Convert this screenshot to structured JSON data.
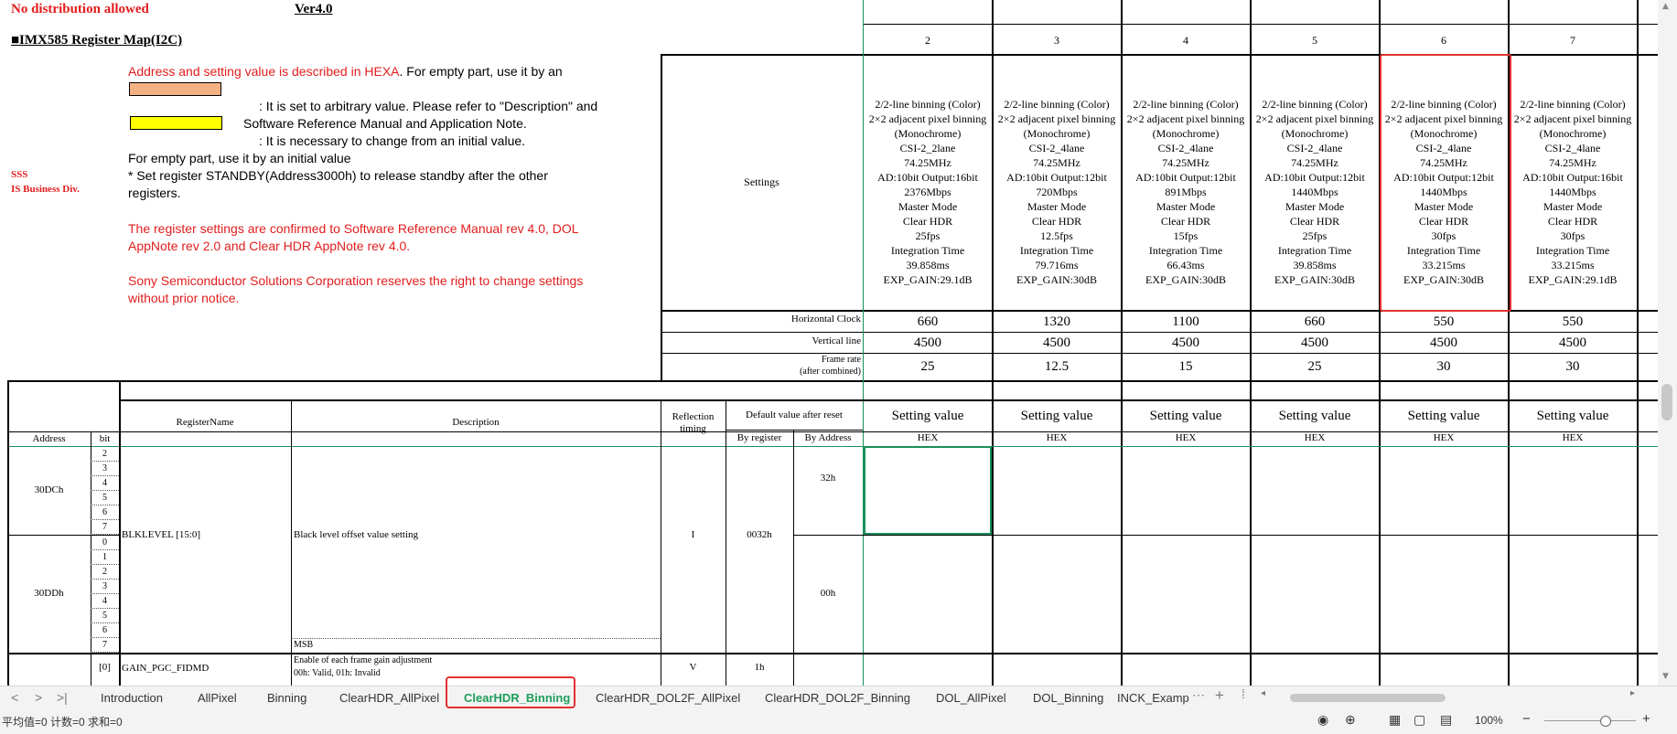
{
  "header": {
    "no_distribution": "No distribution allowed",
    "version": "Ver4.0",
    "map_title": "■IMX585 Register Map(I2C)",
    "sss": "SSS",
    "is_div": "IS Business Div."
  },
  "notes": {
    "line1": "Address and setting value is described in HEXA",
    "line1_rest": ". For empty part, use it by an",
    "orange_desc": ": It is set to arbitrary value. Please refer to \"Description\" and",
    "orange_desc2": "Software Reference Manual and Application Note.",
    "yellow_desc": ": It is necessary to change from an initial value.",
    "empty_part": "For empty part, use it by an initial value",
    "standby": "* Set register STANDBY(Address3000h) to release standby after the other",
    "standby2": "registers.",
    "confirmed1": "The register settings are confirmed to Software Reference Manual rev 4.0, DOL",
    "confirmed2": "AppNote rev 2.0 and Clear HDR AppNote rev 4.0.",
    "sony1": "Sony Semiconductor Solutions Corporation reserves the right to change settings",
    "sony2": "without  prior notice.",
    "colors": {
      "orange": "#f4b183",
      "yellow": "#ffff00",
      "red": "#e21d1d"
    }
  },
  "settings_label": "Settings",
  "row_labels": {
    "hclock": "Horizontal Clock",
    "vline": "Vertical line",
    "frame_rate_1": "Frame rate",
    "frame_rate_2": "(after combined)"
  },
  "columns": [
    {
      "num": "2",
      "lines": [
        "2/2-line binning (Color)",
        "2×2 adjacent pixel binning",
        "(Monochrome)",
        "CSI-2_2lane",
        "74.25MHz",
        "AD:10bit Output:16bit",
        "2376Mbps",
        "Master Mode",
        "Clear HDR",
        "25fps",
        "Integration Time",
        "39.858ms",
        "EXP_GAIN:29.1dB"
      ],
      "hclock": "660",
      "vline": "4500",
      "fps": "25",
      "sv": "Setting value",
      "hex": "HEX"
    },
    {
      "num": "3",
      "lines": [
        "2/2-line binning (Color)",
        "2×2 adjacent pixel binning",
        "(Monochrome)",
        "CSI-2_4lane",
        "74.25MHz",
        "AD:10bit Output:12bit",
        "720Mbps",
        "Master Mode",
        "Clear HDR",
        "12.5fps",
        "Integration Time",
        "79.716ms",
        "EXP_GAIN:30dB"
      ],
      "hclock": "1320",
      "vline": "4500",
      "fps": "12.5",
      "sv": "Setting value",
      "hex": "HEX"
    },
    {
      "num": "4",
      "lines": [
        "2/2-line binning (Color)",
        "2×2 adjacent pixel binning",
        "(Monochrome)",
        "CSI-2_4lane",
        "74.25MHz",
        "AD:10bit Output:12bit",
        "891Mbps",
        "Master Mode",
        "Clear HDR",
        "15fps",
        "Integration Time",
        "66.43ms",
        "EXP_GAIN:30dB"
      ],
      "hclock": "1100",
      "vline": "4500",
      "fps": "15",
      "sv": "Setting value",
      "hex": "HEX"
    },
    {
      "num": "5",
      "lines": [
        "2/2-line binning (Color)",
        "2×2 adjacent pixel binning",
        "(Monochrome)",
        "CSI-2_4lane",
        "74.25MHz",
        "AD:10bit Output:12bit",
        "1440Mbps",
        "Master Mode",
        "Clear HDR",
        "25fps",
        "Integration Time",
        "39.858ms",
        "EXP_GAIN:30dB"
      ],
      "hclock": "660",
      "vline": "4500",
      "fps": "25",
      "sv": "Setting value",
      "hex": "HEX"
    },
    {
      "num": "6",
      "lines": [
        "2/2-line binning (Color)",
        "2×2 adjacent pixel binning",
        "(Monochrome)",
        "CSI-2_4lane",
        "74.25MHz",
        "AD:10bit Output:12bit",
        "1440Mbps",
        "Master Mode",
        "Clear HDR",
        "30fps",
        "Integration Time",
        "33.215ms",
        "EXP_GAIN:30dB"
      ],
      "hclock": "550",
      "vline": "4500",
      "fps": "30",
      "sv": "Setting value",
      "hex": "HEX"
    },
    {
      "num": "7",
      "lines": [
        "2/2-line binning (Color)",
        "2×2 adjacent pixel binning",
        "(Monochrome)",
        "CSI-2_4lane",
        "74.25MHz",
        "AD:10bit Output:16bit",
        "1440Mbps",
        "Master Mode",
        "Clear HDR",
        "30fps",
        "Integration Time",
        "33.215ms",
        "EXP_GAIN:29.1dB"
      ],
      "hclock": "550",
      "vline": "4500",
      "fps": "30",
      "sv": "Setting value",
      "hex": "HEX"
    }
  ],
  "table_head": {
    "register_name": "RegisterName",
    "description": "Description",
    "reflection": "Reflection",
    "timing": "timing",
    "default": "Default value after reset",
    "by_register": "By register",
    "by_address": "By Address",
    "address": "Address",
    "bit": "bit"
  },
  "rows": {
    "addr1": "30DCh",
    "addr2": "30DDh",
    "bits1": [
      "2",
      "3",
      "4",
      "5",
      "6",
      "7"
    ],
    "bits2": [
      "0",
      "1",
      "2",
      "3",
      "4",
      "5",
      "6",
      "7"
    ],
    "reg_name": "BLKLEVEL [15:0]",
    "desc": "Black level offset value setting",
    "msb": "MSB",
    "timing": "I",
    "by_register": "0032h",
    "by_address1": "32h",
    "by_address2": "00h",
    "row3_bit": "[0]",
    "row3_name": "GAIN_PGC_FIDMD",
    "row3_desc1": "Enable of each frame gain adjustment",
    "row3_desc2": "00h: Valid, 01h: Invalid",
    "row3_timing": "V",
    "row3_default": "1h"
  },
  "tabs": [
    "Introduction",
    "AllPixel",
    "Binning",
    "ClearHDR_AllPixel",
    "ClearHDR_Binning",
    "ClearHDR_DOL2F_AllPixel",
    "ClearHDR_DOL2F_Binning",
    "DOL_AllPixel",
    "DOL_Binning",
    "INCK_Examp"
  ],
  "active_tab": "ClearHDR_Binning",
  "status": {
    "summary": "平均值=0  计数=0  求和=0",
    "zoom": "100%"
  }
}
